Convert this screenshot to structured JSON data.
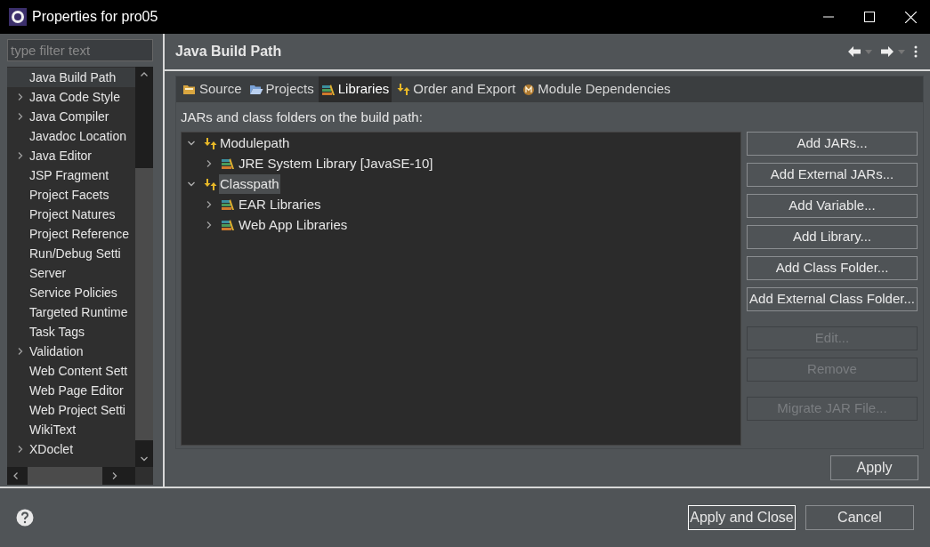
{
  "window": {
    "title": "Properties for pro05"
  },
  "filter": {
    "placeholder": "type filter text"
  },
  "sidebar": {
    "items": [
      {
        "label": "Java Build Path",
        "expandable": false,
        "selected": true
      },
      {
        "label": "Java Code Style",
        "expandable": true,
        "selected": false
      },
      {
        "label": "Java Compiler",
        "expandable": true,
        "selected": false
      },
      {
        "label": "Javadoc Location",
        "expandable": false,
        "selected": false
      },
      {
        "label": "Java Editor",
        "expandable": true,
        "selected": false
      },
      {
        "label": "JSP Fragment",
        "expandable": false,
        "selected": false
      },
      {
        "label": "Project Facets",
        "expandable": false,
        "selected": false
      },
      {
        "label": "Project Natures",
        "expandable": false,
        "selected": false
      },
      {
        "label": "Project Reference",
        "expandable": false,
        "selected": false
      },
      {
        "label": "Run/Debug Setti",
        "expandable": false,
        "selected": false
      },
      {
        "label": "Server",
        "expandable": false,
        "selected": false
      },
      {
        "label": "Service Policies",
        "expandable": false,
        "selected": false
      },
      {
        "label": "Targeted Runtime",
        "expandable": false,
        "selected": false
      },
      {
        "label": "Task Tags",
        "expandable": false,
        "selected": false
      },
      {
        "label": "Validation",
        "expandable": true,
        "selected": false
      },
      {
        "label": "Web Content Sett",
        "expandable": false,
        "selected": false
      },
      {
        "label": "Web Page Editor",
        "expandable": false,
        "selected": false
      },
      {
        "label": "Web Project Setti",
        "expandable": false,
        "selected": false
      },
      {
        "label": "WikiText",
        "expandable": false,
        "selected": false
      },
      {
        "label": "XDoclet",
        "expandable": true,
        "selected": false
      }
    ]
  },
  "page": {
    "title": "Java Build Path",
    "tabs": [
      {
        "label": "Source",
        "kind": "source",
        "selected": false
      },
      {
        "label": "Projects",
        "kind": "projects",
        "selected": false
      },
      {
        "label": "Libraries",
        "kind": "libraries",
        "selected": true
      },
      {
        "label": "Order and Export",
        "kind": "order",
        "selected": false
      },
      {
        "label": "Module Dependencies",
        "kind": "module",
        "selected": false
      }
    ],
    "tree_caption": "JARs and class folders on the build path:",
    "tree": [
      {
        "label": "Modulepath",
        "kind": "container",
        "expanded": true,
        "selected": false,
        "children": [
          {
            "label": "JRE System Library [JavaSE-10]",
            "kind": "library",
            "expanded": false,
            "selected": false
          }
        ]
      },
      {
        "label": "Classpath",
        "kind": "container",
        "expanded": true,
        "selected": true,
        "children": [
          {
            "label": "EAR Libraries",
            "kind": "library",
            "expanded": false,
            "selected": false
          },
          {
            "label": "Web App Libraries",
            "kind": "library",
            "expanded": false,
            "selected": false
          }
        ]
      }
    ],
    "button_groups": [
      [
        {
          "label": "Add JARs...",
          "disabled": false
        },
        {
          "label": "Add External JARs...",
          "disabled": false
        },
        {
          "label": "Add Variable...",
          "disabled": false
        },
        {
          "label": "Add Library...",
          "disabled": false
        },
        {
          "label": "Add Class Folder...",
          "disabled": false
        },
        {
          "label": "Add External Class Folder...",
          "disabled": false
        }
      ],
      [
        {
          "label": "Edit...",
          "disabled": true
        },
        {
          "label": "Remove",
          "disabled": true
        }
      ],
      [
        {
          "label": "Migrate JAR File...",
          "disabled": true
        }
      ]
    ],
    "apply": "Apply"
  },
  "footer": {
    "buttons": [
      {
        "label": "Apply and Close",
        "default": true
      },
      {
        "label": "Cancel",
        "default": false
      }
    ]
  }
}
